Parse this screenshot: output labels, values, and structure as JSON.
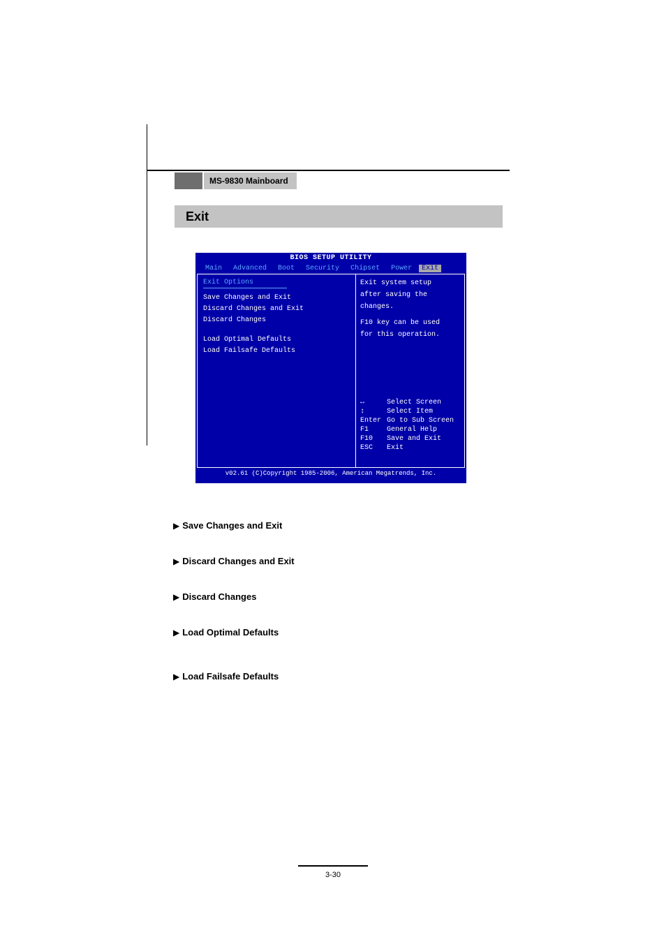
{
  "header": {
    "product": "MS-9830 Mainboard"
  },
  "section": {
    "title": "Exit"
  },
  "bios": {
    "title": "BIOS SETUP UTILITY",
    "tabs": [
      "Main",
      "Advanced",
      "Boot",
      "Security",
      "Chipset",
      "Power",
      "Exit"
    ],
    "active_tab": "Exit",
    "left_panel": {
      "heading": "Exit Options",
      "items_group1": [
        "Save Changes and Exit",
        "Discard Changes and Exit",
        "Discard Changes"
      ],
      "items_group2": [
        "Load Optimal Defaults",
        "Load Failsafe Defaults"
      ]
    },
    "right_panel": {
      "help_line1": "Exit system setup",
      "help_line2": "after saving the",
      "help_line3": "changes.",
      "help_line4": "F10 key can be used",
      "help_line5": "for this operation.",
      "keys": [
        {
          "key": "↔",
          "action": "Select Screen"
        },
        {
          "key": "↕",
          "action": "Select Item"
        },
        {
          "key": "Enter",
          "action": "Go to Sub Screen"
        },
        {
          "key": "F1",
          "action": "General Help"
        },
        {
          "key": "F10",
          "action": "Save and Exit"
        },
        {
          "key": "ESC",
          "action": "Exit"
        }
      ]
    },
    "footer": "v02.61 (C)Copyright 1985-2006, American Megatrends, Inc."
  },
  "descriptions": [
    "Save Changes and Exit",
    "Discard Changes and Exit",
    "Discard Changes",
    "Load Optimal Defaults",
    "Load Failsafe Defaults"
  ],
  "page_number": "3-30"
}
